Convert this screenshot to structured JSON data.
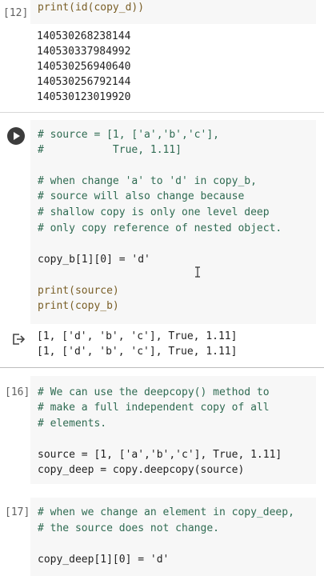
{
  "cells": {
    "c12": {
      "label": "[12]",
      "code": "print(id(copy_d))",
      "output": [
        "140530268238144",
        "140530337984992",
        "140530256940640",
        "140530256792144",
        "140530123019920"
      ]
    },
    "c13": {
      "lines": [
        "# source = [1, ['a','b','c'],",
        "#           True, 1.11]",
        "",
        "# when change 'a' to 'd' in copy_b,",
        "# source will also change because",
        "# shallow copy is only one level deep",
        "# only copy reference of nested object.",
        "",
        "copy_b[1][0] = 'd'",
        "",
        "print(source)",
        "print(copy_b)"
      ],
      "output": [
        "[1, ['d', 'b', 'c'], True, 1.11]",
        "[1, ['d', 'b', 'c'], True, 1.11]"
      ]
    },
    "c16": {
      "label": "[16]",
      "lines": [
        "# We can use the deepcopy() method to",
        "# make a full independent copy of all",
        "# elements.",
        "",
        "source = [1, ['a','b','c'], True, 1.11]",
        "copy_deep = copy.deepcopy(source)"
      ]
    },
    "c17": {
      "label": "[17]",
      "lines": [
        "# when we change an element in copy_deep,",
        "# the source does not change.",
        "",
        "copy_deep[1][0] = 'd'"
      ]
    }
  },
  "icons": {
    "run": "play-circle-icon",
    "output": "output-arrow-icon",
    "cursor": "text-cursor-icon"
  },
  "colors": {
    "comment": "#2f6b52",
    "string": "#a31515",
    "number": "#098658",
    "keyword": "#0000ff",
    "function": "#795e26",
    "cell_bg": "#f7f7f7"
  }
}
